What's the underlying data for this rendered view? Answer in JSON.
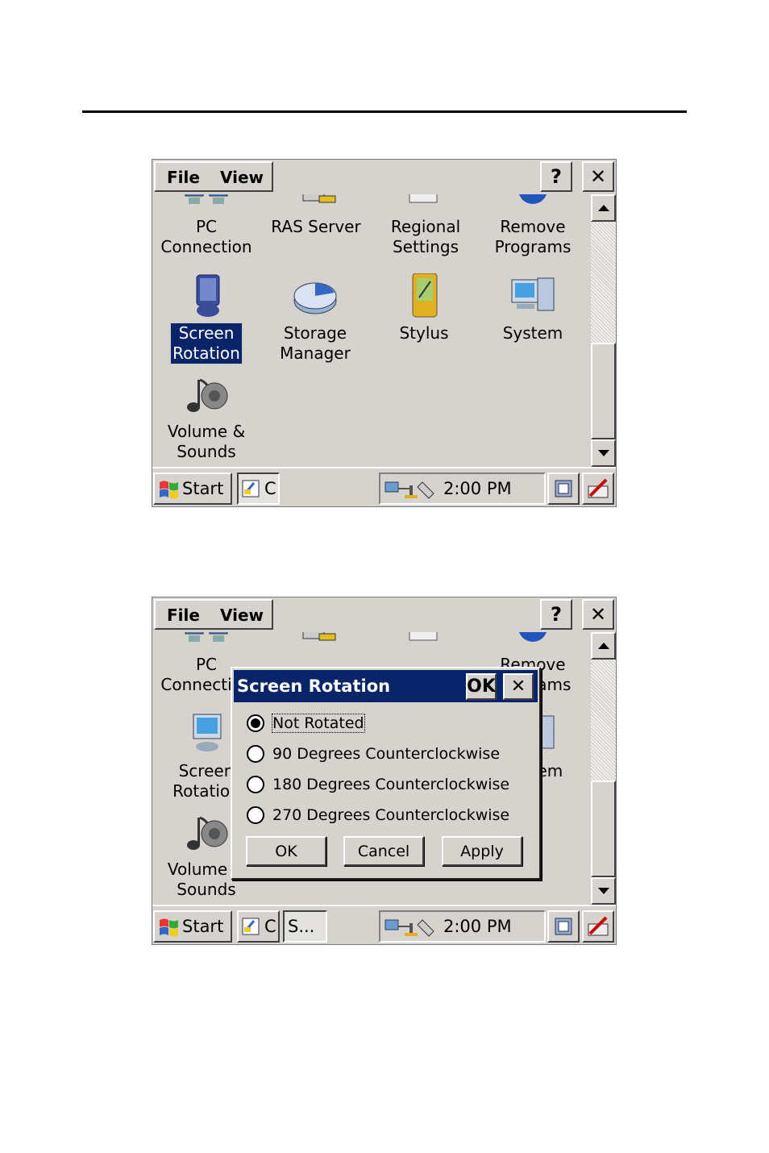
{
  "menubar": {
    "file": "File",
    "view": "View",
    "help": "?",
    "close": "✕"
  },
  "items": [
    {
      "label": "PC\nConnection"
    },
    {
      "label": "RAS Server"
    },
    {
      "label": "Regional\nSettings"
    },
    {
      "label": "Remove\nPrograms"
    },
    {
      "label": "Screen\nRotation"
    },
    {
      "label": "Storage\nManager"
    },
    {
      "label": "Stylus"
    },
    {
      "label": "System"
    },
    {
      "label": "Volume &\nSounds"
    }
  ],
  "taskbar": {
    "start": "Start",
    "task_c": "C",
    "task_s": "S...",
    "time": "2:00 PM"
  },
  "dialog": {
    "title": "Screen Rotation",
    "ok_title": "OK",
    "close": "✕",
    "options": [
      "Not Rotated",
      "90 Degrees Counterclockwise",
      "180 Degrees Counterclockwise",
      "270 Degrees Counterclockwise"
    ],
    "selected": "Not Rotated",
    "ok": "OK",
    "cancel": "Cancel",
    "apply": "Apply"
  },
  "colors": {
    "title_bar": "#0a246a",
    "face": "#d6d3ce",
    "selection": "#0a246a"
  },
  "icons": [
    "pc-connection-icon",
    "ras-server-icon",
    "regional-settings-icon",
    "remove-programs-icon",
    "screen-rotation-icon",
    "storage-manager-icon",
    "stylus-icon",
    "system-icon",
    "volume-sounds-icon",
    "windows-flag-icon",
    "network-tray-icon",
    "keyboard-icon",
    "pen-icon"
  ]
}
